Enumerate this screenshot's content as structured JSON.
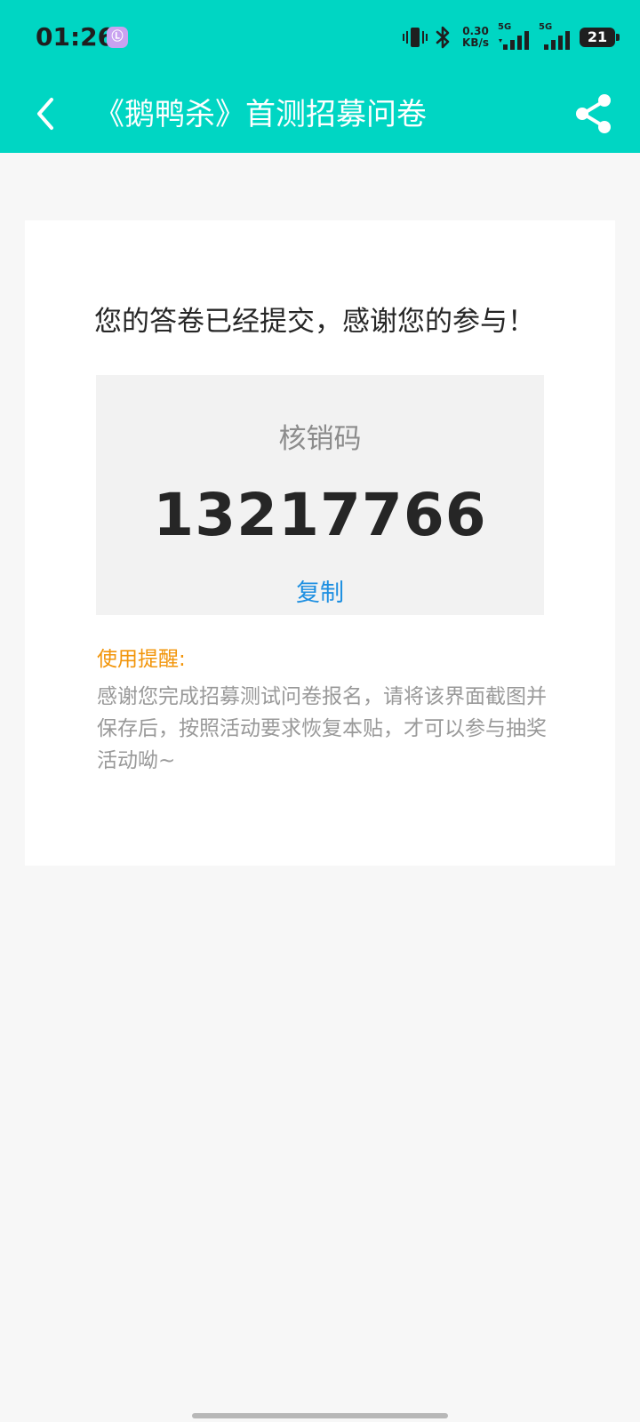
{
  "status_bar": {
    "time": "01:26",
    "notification_icon": "pink-app-icon",
    "notification_symbol": "Ⓛ",
    "net_speed_value": "0.30",
    "net_speed_unit": "KB/s",
    "signal_1_label": "5G",
    "signal_2_label": "5G",
    "battery_level": "21"
  },
  "header": {
    "title": "《鹅鸭杀》首测招募问卷",
    "back_icon": "back-arrow-icon",
    "share_icon": "share-icon"
  },
  "main": {
    "success_message": "您的答卷已经提交，感谢您的参与！",
    "code_label": "核销码",
    "code_value": "13217766",
    "copy_label": "复制",
    "reminder_title": "使用提醒:",
    "reminder_text": "感谢您完成招募测试问卷报名，请将该界面截图并保存后，按照活动要求恢复本贴，才可以参与抽奖活动呦~"
  },
  "colors": {
    "header_bg": "#00d6c3",
    "page_bg": "#f7f7f7",
    "copy_link": "#1d8fe1",
    "reminder_title": "#f2950a",
    "reminder_text": "#999999"
  }
}
